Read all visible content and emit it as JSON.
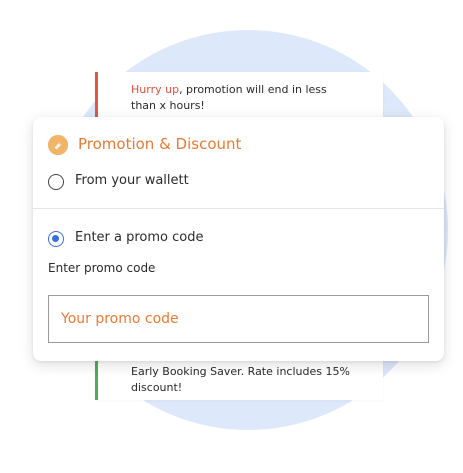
{
  "notice_top": {
    "highlight": "Hurry up",
    "text": ", promotion will end in less than x hours!"
  },
  "notice_bottom": {
    "text": "Early Booking Saver. Rate includes 15% discount!"
  },
  "promotion": {
    "title": "Promotion & Discount",
    "options": [
      {
        "label": "From your wallett",
        "selected": false
      },
      {
        "label": "Enter a promo code",
        "selected": true
      }
    ],
    "field_label": "Enter promo code",
    "input_placeholder": "Your promo code",
    "input_value": ""
  },
  "colors": {
    "accent": "#e87b33",
    "selected_radio": "#3a6fe0",
    "urgent": "#e05747",
    "success": "#4cae56",
    "background_circle": "#dde8fb"
  },
  "icons": {
    "logo": "coin-tag-icon"
  }
}
